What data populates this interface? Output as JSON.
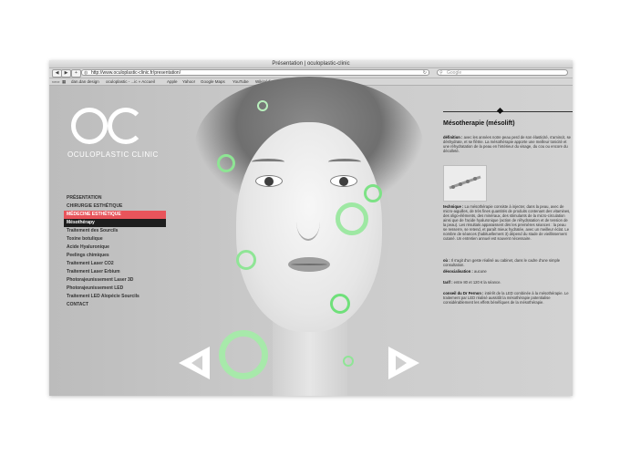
{
  "browser": {
    "window_title": "Présentation | oculoplastic-clinic",
    "url": "http://www.oculoplastic-clinic.fr/presentation/",
    "search_placeholder": "Google",
    "bookmarks": [
      "dan.dan design",
      "oculoplastic - ...ic » Accueil",
      "Apple",
      "Yahoo!",
      "Google Maps",
      "YouTube",
      "Wikipédia",
      "Informations ▾",
      "Divers ▾"
    ]
  },
  "logo": {
    "letters": "OC",
    "text": "OCULOPLASTIC CLINIC"
  },
  "menu": {
    "items": [
      "PRÉSENTATION",
      "CHIRURGIE ESTHÉTIQUE",
      "MÉDECINE ESTHÉTIQUE",
      "Mésothérapy",
      "Traitement des Sourcils",
      "Toxine botulique",
      "Acide Hyaluronique",
      "Peelings chimiques",
      "Traitement Laser CO2",
      "Traitement Laser Erbium",
      "Photorajeunissement Laser 3D",
      "Photorajeunissement LED",
      "Traitement LED Alopécie Sourcils",
      "CONTACT"
    ]
  },
  "content": {
    "heading": "Mésotherapie (mésolift)",
    "definition_label": "définition :",
    "definition": "avec les années notre peau perd de son élasticité, s'amincit, se déshydrate, et se flétrie. La mésothérapie apporte une meilleur tonicité et une réhydratation de la peau en l'intérieur du visage, du cou ou encore du décolleté.",
    "technique_label": "technique :",
    "technique": "La mésothérapie consiste à injecter, dans la peau, avec de micro-aiguilles, de très fines quantités de produits contenant des vitamines, des oligo-éléments, des minéraux, des stimulants de la micro-circulation ainsi que de l'acide hyaluronique (action de réhydratation et de tension de la peau). Les résultats apparaissent dès les premières séances : la peau se resserre, se retend, et paraît mieux hydratée, avec un meilleur éclat. Le nombre de séances (habituellement 3) dépend du stade de vieillissement cutané. Un entretien annuel est souvent nécessaire.",
    "ou_label": "où :",
    "ou": "Il s'agit d'un geste réalisé au cabinet, dans le cadre d'une simple consultation.",
    "desocialisation_label": "désocialisation :",
    "desocialisation": "aucune",
    "tarif_label": "tarif :",
    "tarif": "entre 80 et 120 € la séance.",
    "conseil_label": "conseil du Dr Fernon :",
    "conseil": "intérêt de la LED combinée à la mésothérapie. Le traitement par LED réalisé aussitôt la mésothérapie potentialise considérablement les effets bénéfiques de la mésothérapie."
  },
  "colors": {
    "accent_red": "#e8545b",
    "ring_green": "#6fe07a",
    "dark": "#1e1e1e"
  },
  "icons": [
    "back-arrow-icon",
    "forward-arrow-icon",
    "plus-icon",
    "lock-icon",
    "reload-icon",
    "search-icon",
    "reader-icon",
    "prev-arrow-icon",
    "next-arrow-icon",
    "diamond-icon"
  ]
}
